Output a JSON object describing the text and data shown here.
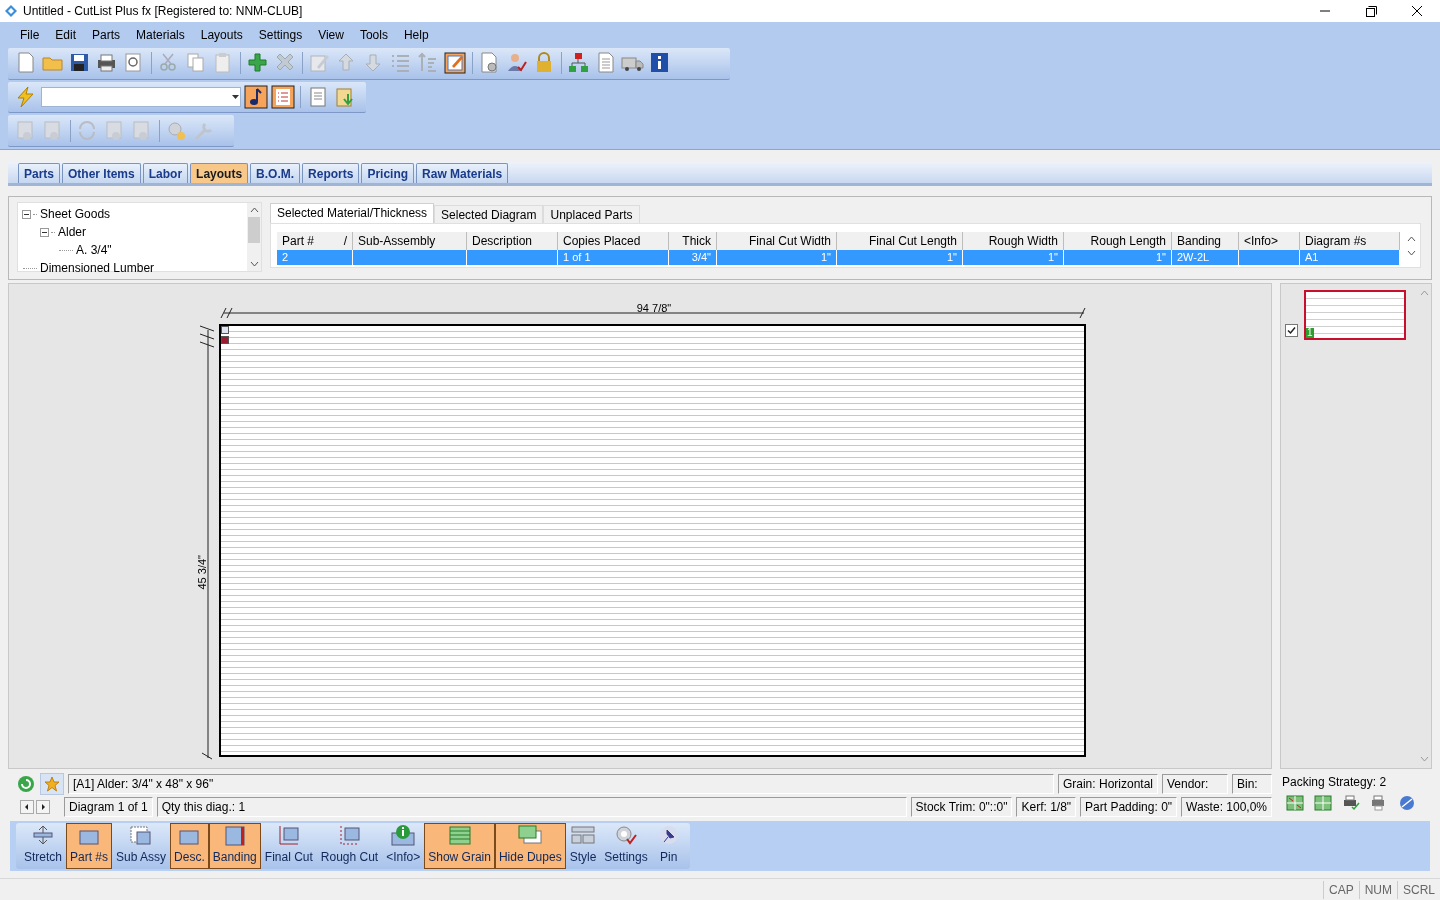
{
  "window": {
    "title": "Untitled - CutList Plus fx [Registered to: NNM-CLUB]"
  },
  "menu": [
    "File",
    "Edit",
    "Parts",
    "Materials",
    "Layouts",
    "Settings",
    "View",
    "Tools",
    "Help"
  ],
  "tabs": [
    {
      "label": "Parts",
      "selected": false
    },
    {
      "label": "Other Items",
      "selected": false
    },
    {
      "label": "Labor",
      "selected": false
    },
    {
      "label": "Layouts",
      "selected": true
    },
    {
      "label": "B.O.M.",
      "selected": false
    },
    {
      "label": "Reports",
      "selected": false
    },
    {
      "label": "Pricing",
      "selected": false
    },
    {
      "label": "Raw Materials",
      "selected": false
    }
  ],
  "tree": [
    {
      "label": "Sheet Goods",
      "expanded": true,
      "children": [
        {
          "label": "Alder",
          "expanded": true,
          "children": [
            {
              "label": "A. 3/4\""
            }
          ]
        }
      ]
    },
    {
      "label": "Dimensioned Lumber"
    }
  ],
  "detail_tabs": [
    {
      "label": "Selected Material/Thickness",
      "selected": true
    },
    {
      "label": "Selected Diagram",
      "selected": false
    },
    {
      "label": "Unplaced Parts",
      "selected": false
    }
  ],
  "table": {
    "columns": [
      {
        "label": "Part #",
        "kind": "text",
        "sort_mark": "/"
      },
      {
        "label": "Sub-Assembly",
        "kind": "text"
      },
      {
        "label": "Description",
        "kind": "text"
      },
      {
        "label": "Copies Placed",
        "kind": "text"
      },
      {
        "label": "Thick",
        "kind": "number"
      },
      {
        "label": "Final Cut Width",
        "kind": "number"
      },
      {
        "label": "Final Cut Length",
        "kind": "number"
      },
      {
        "label": "Rough Width",
        "kind": "number"
      },
      {
        "label": "Rough Length",
        "kind": "number"
      },
      {
        "label": "Banding",
        "kind": "text"
      },
      {
        "label": "<Info>",
        "kind": "text"
      },
      {
        "label": "Diagram #s",
        "kind": "text"
      }
    ],
    "rows": [
      {
        "selected": true,
        "cells": [
          "2",
          null,
          null,
          "1 of 1",
          "3/4\"",
          "1\"",
          "1\"",
          "1\"",
          "1\"",
          "2W-2L",
          null,
          "A1"
        ]
      }
    ]
  },
  "diagram": {
    "width_label": "94 7/8\"",
    "height_label": "45 3/4\"",
    "parts": [
      {
        "color": "#dde4f4"
      },
      {
        "color": "#9b1b30"
      }
    ]
  },
  "thumbnails": [
    {
      "label": "1",
      "checked": true,
      "selected": true
    }
  ],
  "info": {
    "stock": "[A1] Alder: 3/4\" x 48\" x 96\"",
    "grain": "Grain: Horizontal",
    "vendor": "Vendor:",
    "bin": "Bin:",
    "diagram": "Diagram 1 of 1",
    "qty": "Qty this diag.: 1",
    "stock_trim": "Stock Trim: 0\"::0\"",
    "kerf": "Kerf: 1/8\"",
    "padding": "Part Padding: 0\"",
    "waste": "Waste: 100,0%"
  },
  "packing_strategy": "Packing Strategy: 2",
  "view_buttons": [
    {
      "label": "Stretch",
      "on": false
    },
    {
      "label": "Part #s",
      "on": true
    },
    {
      "label": "Sub Assy",
      "on": false
    },
    {
      "label": "Desc.",
      "on": true
    },
    {
      "label": "Banding",
      "on": true
    },
    {
      "label": "Final Cut",
      "on": false
    },
    {
      "label": "Rough Cut",
      "on": false
    },
    {
      "label": "<Info>",
      "on": false
    },
    {
      "label": "Show Grain",
      "on": true
    },
    {
      "label": "Hide Dupes",
      "on": true
    },
    {
      "label": "Style",
      "on": false
    },
    {
      "label": "Settings",
      "on": false
    },
    {
      "label": "Pin",
      "on": false
    }
  ],
  "status_bar": [
    "CAP",
    "NUM",
    "SCRL"
  ]
}
